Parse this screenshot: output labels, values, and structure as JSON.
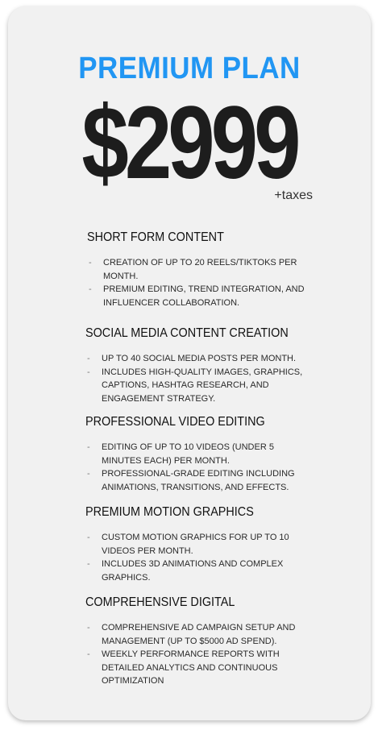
{
  "plan": {
    "title": "PREMIUM PLAN",
    "price": "$2999",
    "price_note": "+taxes"
  },
  "sections": [
    {
      "title": "SHORT FORM CONTENT",
      "items": [
        "CREATION OF UP TO 20 REELS/TIKTOKS PER MONTH.",
        "PREMIUM EDITING, TREND INTEGRATION, AND INFLUENCER COLLABORATION."
      ]
    },
    {
      "title": "SOCIAL MEDIA CONTENT CREATION",
      "items": [
        "UP TO 40 SOCIAL MEDIA POSTS PER MONTH.",
        "INCLUDES HIGH-QUALITY IMAGES, GRAPHICS, CAPTIONS, HASHTAG RESEARCH, AND ENGAGEMENT STRATEGY."
      ]
    },
    {
      "title": "PROFESSIONAL VIDEO EDITING",
      "items": [
        "EDITING OF UP TO 10 VIDEOS (UNDER 5 MINUTES EACH) PER MONTH.",
        "PROFESSIONAL-GRADE EDITING INCLUDING ANIMATIONS, TRANSITIONS, AND EFFECTS."
      ]
    },
    {
      "title": "PREMIUM MOTION GRAPHICS",
      "items": [
        "CUSTOM MOTION GRAPHICS FOR UP TO 10 VIDEOS PER MONTH.",
        "INCLUDES 3D ANIMATIONS AND COMPLEX GRAPHICS."
      ]
    },
    {
      "title": "COMPREHENSIVE DIGITAL",
      "items": [
        "COMPREHENSIVE AD CAMPAIGN SETUP AND MANAGEMENT (UP TO $5000 AD SPEND).",
        "WEEKLY PERFORMANCE REPORTS WITH DETAILED ANALYTICS AND CONTINUOUS OPTIMIZATION"
      ]
    }
  ],
  "list_marker": "-",
  "colors": {
    "accent": "#2196f3",
    "card_background": "#f1f1f1",
    "price_text": "#1d1d1d"
  }
}
